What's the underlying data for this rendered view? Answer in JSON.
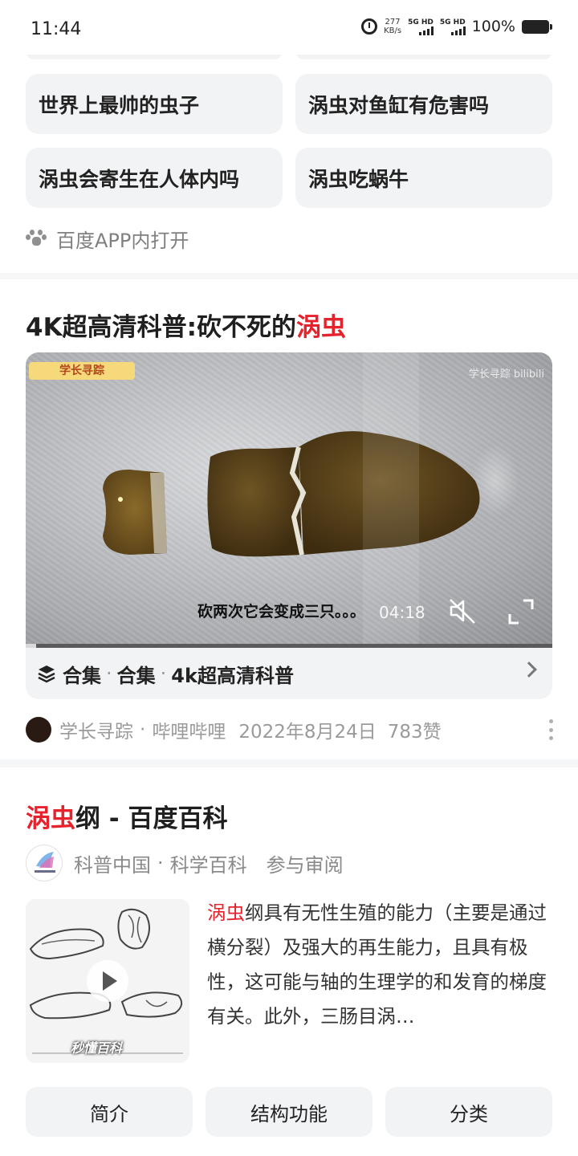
{
  "status_bar": {
    "time": "11:44",
    "speed_value": "277",
    "speed_unit": "KB/s",
    "sim1": "5G HD",
    "sim2": "5G HD",
    "battery": "100%"
  },
  "related_searches": {
    "chips": [
      "世界上最帅的虫子",
      "涡虫对鱼缸有危害吗",
      "涡虫会寄生在人体内吗",
      "涡虫吃蜗牛"
    ],
    "open_app": "百度APP内打开"
  },
  "video_result": {
    "title_prefix": "4K超高清科普:砍不死的",
    "title_highlight": "涡虫",
    "video": {
      "tag": "学长寻踪",
      "watermark": "学长寻踪 bilibili",
      "caption": "砍两次它会变成三只。。。",
      "duration": "04:18",
      "progress": 0.02
    },
    "collection": {
      "label1": "合集",
      "label2": "合集",
      "name": "4k超高清科普"
    },
    "meta": {
      "author": "学长寻踪",
      "platform": "哔哩哔哩",
      "date": "2022年8月24日",
      "likes": "783赞"
    }
  },
  "baike_result": {
    "title_highlight": "涡虫",
    "title_rest": "纲 - 百度百科",
    "source": "科普中国",
    "source_sub": "科学百科",
    "review": "参与审阅",
    "thumb_brand": "秒懂百科",
    "desc_highlight": "涡虫",
    "desc_rest": "纲具有无性生殖的能力（主要是通过横分裂）及强大的再生能力，且具有极性，这可能与轴的生理学的和发育的梯度有关。此外，三肠目涡…",
    "tabs": [
      "简介",
      "结构功能",
      "分类"
    ]
  },
  "colors": {
    "highlight": "#e6222d",
    "chip_bg": "#f2f3f5",
    "meta_gray": "#9a9a9a"
  }
}
